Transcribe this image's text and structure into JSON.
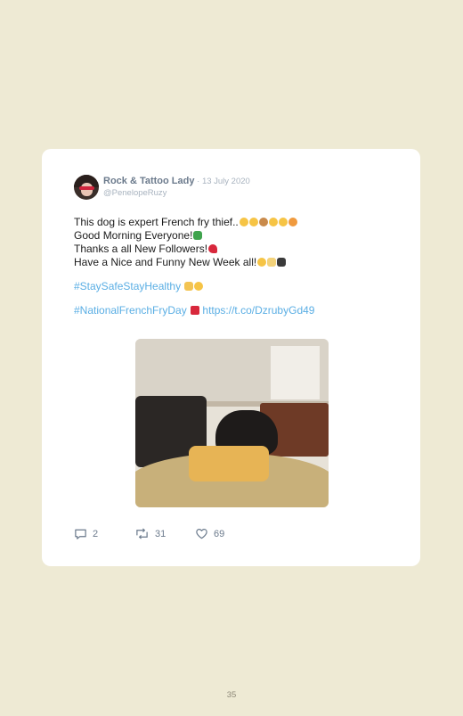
{
  "tweet": {
    "display_name": "Rock & Tattoo Lady",
    "separator": " · ",
    "date": "13 July 2020",
    "handle": "@PenelopeRuzy",
    "lines": [
      "This dog is expert French fry thief..",
      "Good Morning Everyone!",
      "Thanks a all New Followers!",
      "Have a Nice and Funny New Week all!"
    ],
    "hashtag_1": "#StaySafeStayHealthy",
    "hashtag_2": "#NationalFrenchFryDay",
    "link": "https://t.co/DzrubyGd49",
    "replies": "2",
    "retweets": "31",
    "likes": "69",
    "emoji_colors": {
      "laugh": "#f6c445",
      "clover": "#3fa34d",
      "heart": "#d8283c",
      "pray": "#f3c453",
      "fries": "#d8283c"
    }
  },
  "page": {
    "number": "35"
  }
}
